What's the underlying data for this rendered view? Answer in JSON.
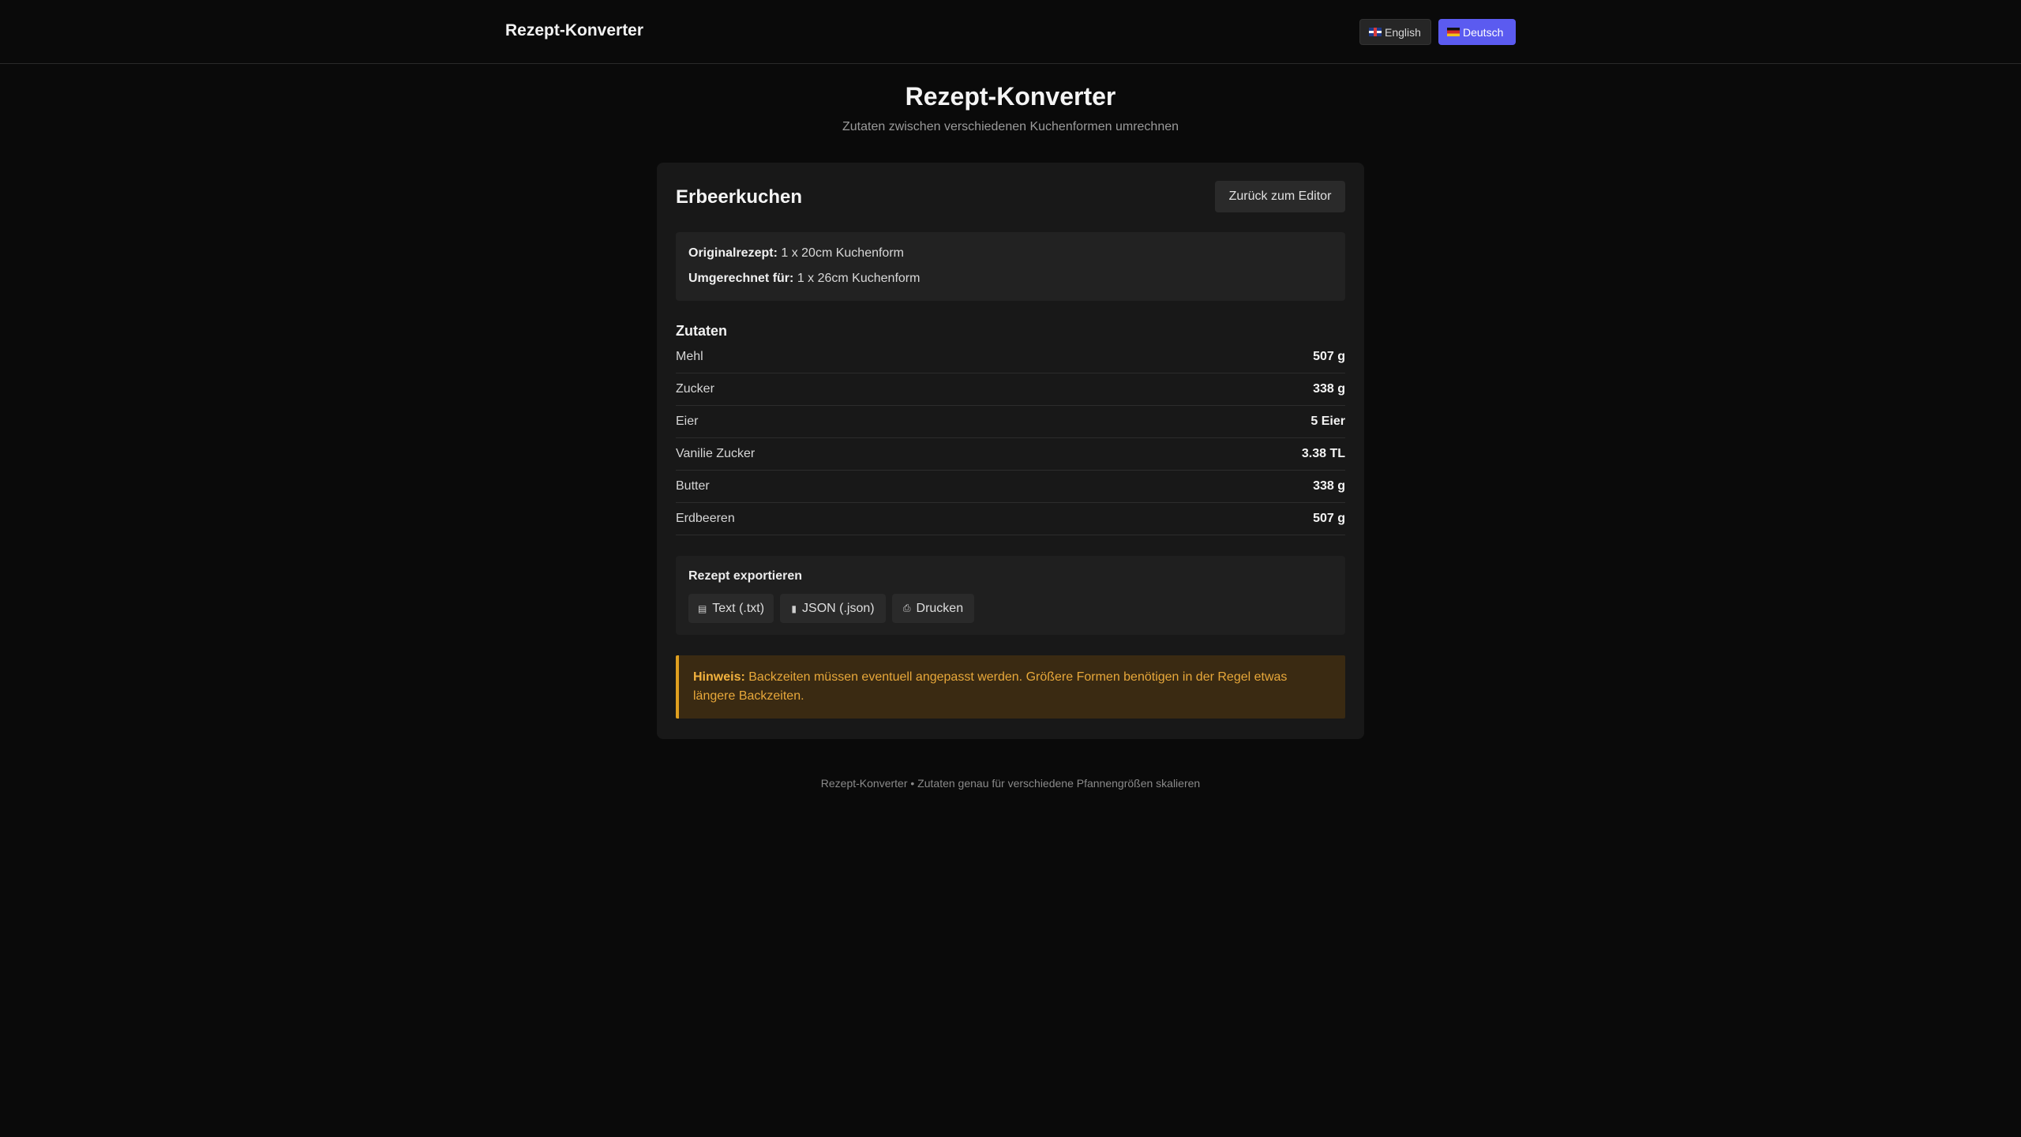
{
  "header": {
    "brand": "Rezept-Konverter",
    "lang_en": "English",
    "lang_de": "Deutsch"
  },
  "hero": {
    "title": "Rezept-Konverter",
    "subtitle": "Zutaten zwischen verschiedenen Kuchenformen umrechnen"
  },
  "card": {
    "title": "Erbeerkuchen",
    "back_label": "Zurück zum Editor",
    "original_label": "Originalrezept:",
    "original_value": "1 x 20cm Kuchenform",
    "converted_label": "Umgerechnet für:",
    "converted_value": "1 x 26cm Kuchenform",
    "ingredients_heading": "Zutaten",
    "ingredients": [
      {
        "name": "Mehl",
        "qty": "507 g"
      },
      {
        "name": "Zucker",
        "qty": "338 g"
      },
      {
        "name": "Eier",
        "qty": "5 Eier"
      },
      {
        "name": "Vanilie Zucker",
        "qty": "3.38 TL"
      },
      {
        "name": "Butter",
        "qty": "338 g"
      },
      {
        "name": "Erdbeeren",
        "qty": "507 g"
      }
    ],
    "export": {
      "heading": "Rezept exportieren",
      "txt_label": "Text (.txt)",
      "json_label": "JSON (.json)",
      "print_label": "Drucken"
    },
    "note": {
      "label": "Hinweis:",
      "text": "Backzeiten müssen eventuell angepasst werden. Größere Formen benötigen in der Regel etwas längere Backzeiten."
    }
  },
  "footer": {
    "text": "Rezept-Konverter • Zutaten genau für verschiedene Pfannengrößen skalieren"
  },
  "colors": {
    "background": "#0a0a0a",
    "card": "#181818",
    "accent": "#5b5bf0",
    "warning": "#e0a020"
  }
}
